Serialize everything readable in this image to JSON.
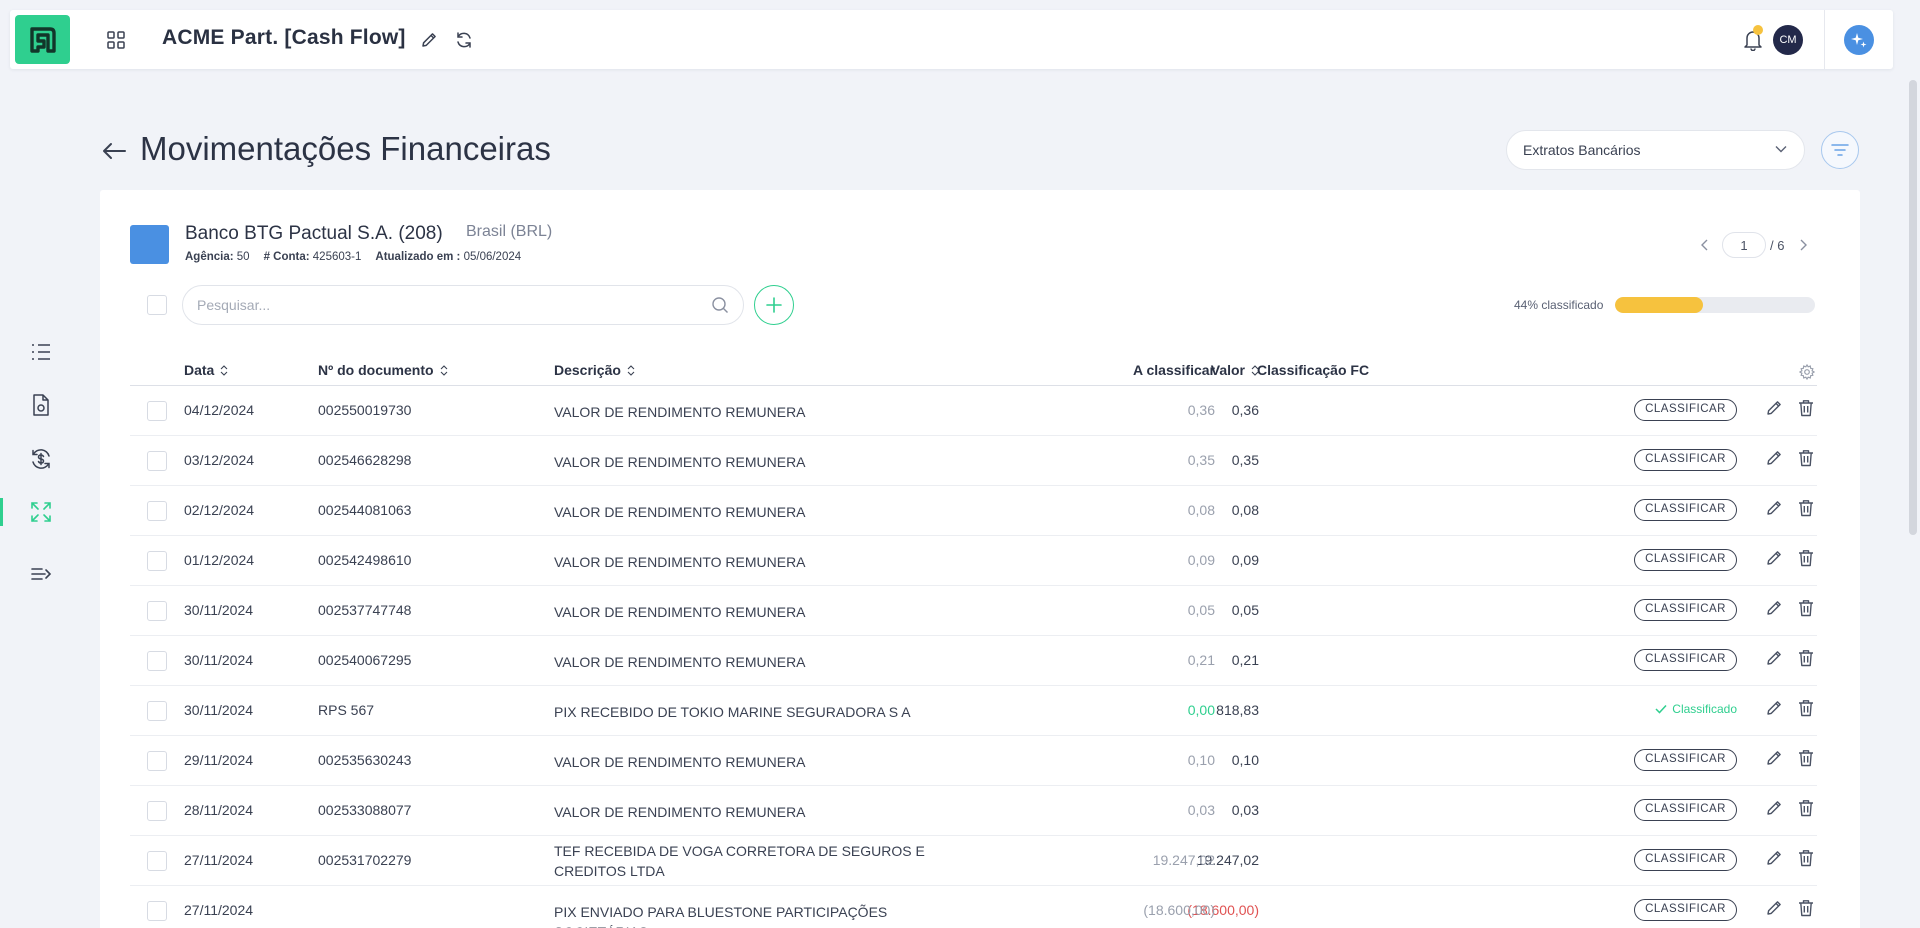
{
  "app": {
    "title": "ACME Part. [Cash Flow]",
    "user_initials": "CM"
  },
  "page": {
    "title": "Movimentações Financeiras",
    "source_select": "Extratos Bancários"
  },
  "bank": {
    "name": "Banco BTG Pactual S.A. (208)",
    "country": "Brasil (BRL)",
    "agencia_label": "Agência:",
    "agencia": "50",
    "conta_label": "# Conta:",
    "conta": "425603-1",
    "atualizado_label": "Atualizado em :",
    "atualizado": "05/06/2024",
    "color": "#4a90e2"
  },
  "pager": {
    "current": "1",
    "total": "/ 6"
  },
  "search": {
    "placeholder": "Pesquisar..."
  },
  "progress": {
    "label": "44% classificado",
    "fraction": 0.44
  },
  "table": {
    "columns": {
      "data": "Data",
      "documento": "Nº do documento",
      "descricao": "Descrição",
      "valor": "Valor",
      "a_classificar": "A classificar",
      "classificacao": "Classificação FC"
    },
    "classify_label": "CLASSIFICAR",
    "classified_label": "Classificado",
    "rows": [
      {
        "date": "04/12/2024",
        "doc": "002550019730",
        "desc": "VALOR DE RENDIMENTO REMUNERA",
        "valor": "0,36",
        "acl": "0,36",
        "status": "pending",
        "negative": false
      },
      {
        "date": "03/12/2024",
        "doc": "002546628298",
        "desc": "VALOR DE RENDIMENTO REMUNERA",
        "valor": "0,35",
        "acl": "0,35",
        "status": "pending",
        "negative": false
      },
      {
        "date": "02/12/2024",
        "doc": "002544081063",
        "desc": "VALOR DE RENDIMENTO REMUNERA",
        "valor": "0,08",
        "acl": "0,08",
        "status": "pending",
        "negative": false
      },
      {
        "date": "01/12/2024",
        "doc": "002542498610",
        "desc": "VALOR DE RENDIMENTO REMUNERA",
        "valor": "0,09",
        "acl": "0,09",
        "status": "pending",
        "negative": false
      },
      {
        "date": "30/11/2024",
        "doc": "002537747748",
        "desc": "VALOR DE RENDIMENTO REMUNERA",
        "valor": "0,05",
        "acl": "0,05",
        "status": "pending",
        "negative": false
      },
      {
        "date": "30/11/2024",
        "doc": "002540067295",
        "desc": "VALOR DE RENDIMENTO REMUNERA",
        "valor": "0,21",
        "acl": "0,21",
        "status": "pending",
        "negative": false
      },
      {
        "date": "30/11/2024",
        "doc": "RPS 567",
        "desc": "PIX RECEBIDO DE TOKIO MARINE SEGURADORA S A",
        "valor": "818,83",
        "acl": "0,00",
        "status": "classified",
        "negative": false
      },
      {
        "date": "29/11/2024",
        "doc": "002535630243",
        "desc": "VALOR DE RENDIMENTO REMUNERA",
        "valor": "0,10",
        "acl": "0,10",
        "status": "pending",
        "negative": false
      },
      {
        "date": "28/11/2024",
        "doc": "002533088077",
        "desc": "VALOR DE RENDIMENTO REMUNERA",
        "valor": "0,03",
        "acl": "0,03",
        "status": "pending",
        "negative": false
      },
      {
        "date": "27/11/2024",
        "doc": "002531702279",
        "desc": "TEF RECEBIDA DE VOGA CORRETORA DE SEGUROS E CREDITOS LTDA",
        "valor": "19.247,02",
        "acl": "19.247,02",
        "status": "pending",
        "negative": false
      },
      {
        "date": "27/11/2024",
        "doc": "",
        "desc": "PIX ENVIADO PARA BLUESTONE PARTICIPAÇÕES SOCIETÁRIAS",
        "valor": "(18.600,00)",
        "acl": "(18.600,00)",
        "status": "pending",
        "negative": true
      }
    ]
  },
  "colors": {
    "accent": "#2fcf8f",
    "progress": "#f6c23e",
    "negative": "#e05252",
    "bank": "#4a90e2"
  }
}
